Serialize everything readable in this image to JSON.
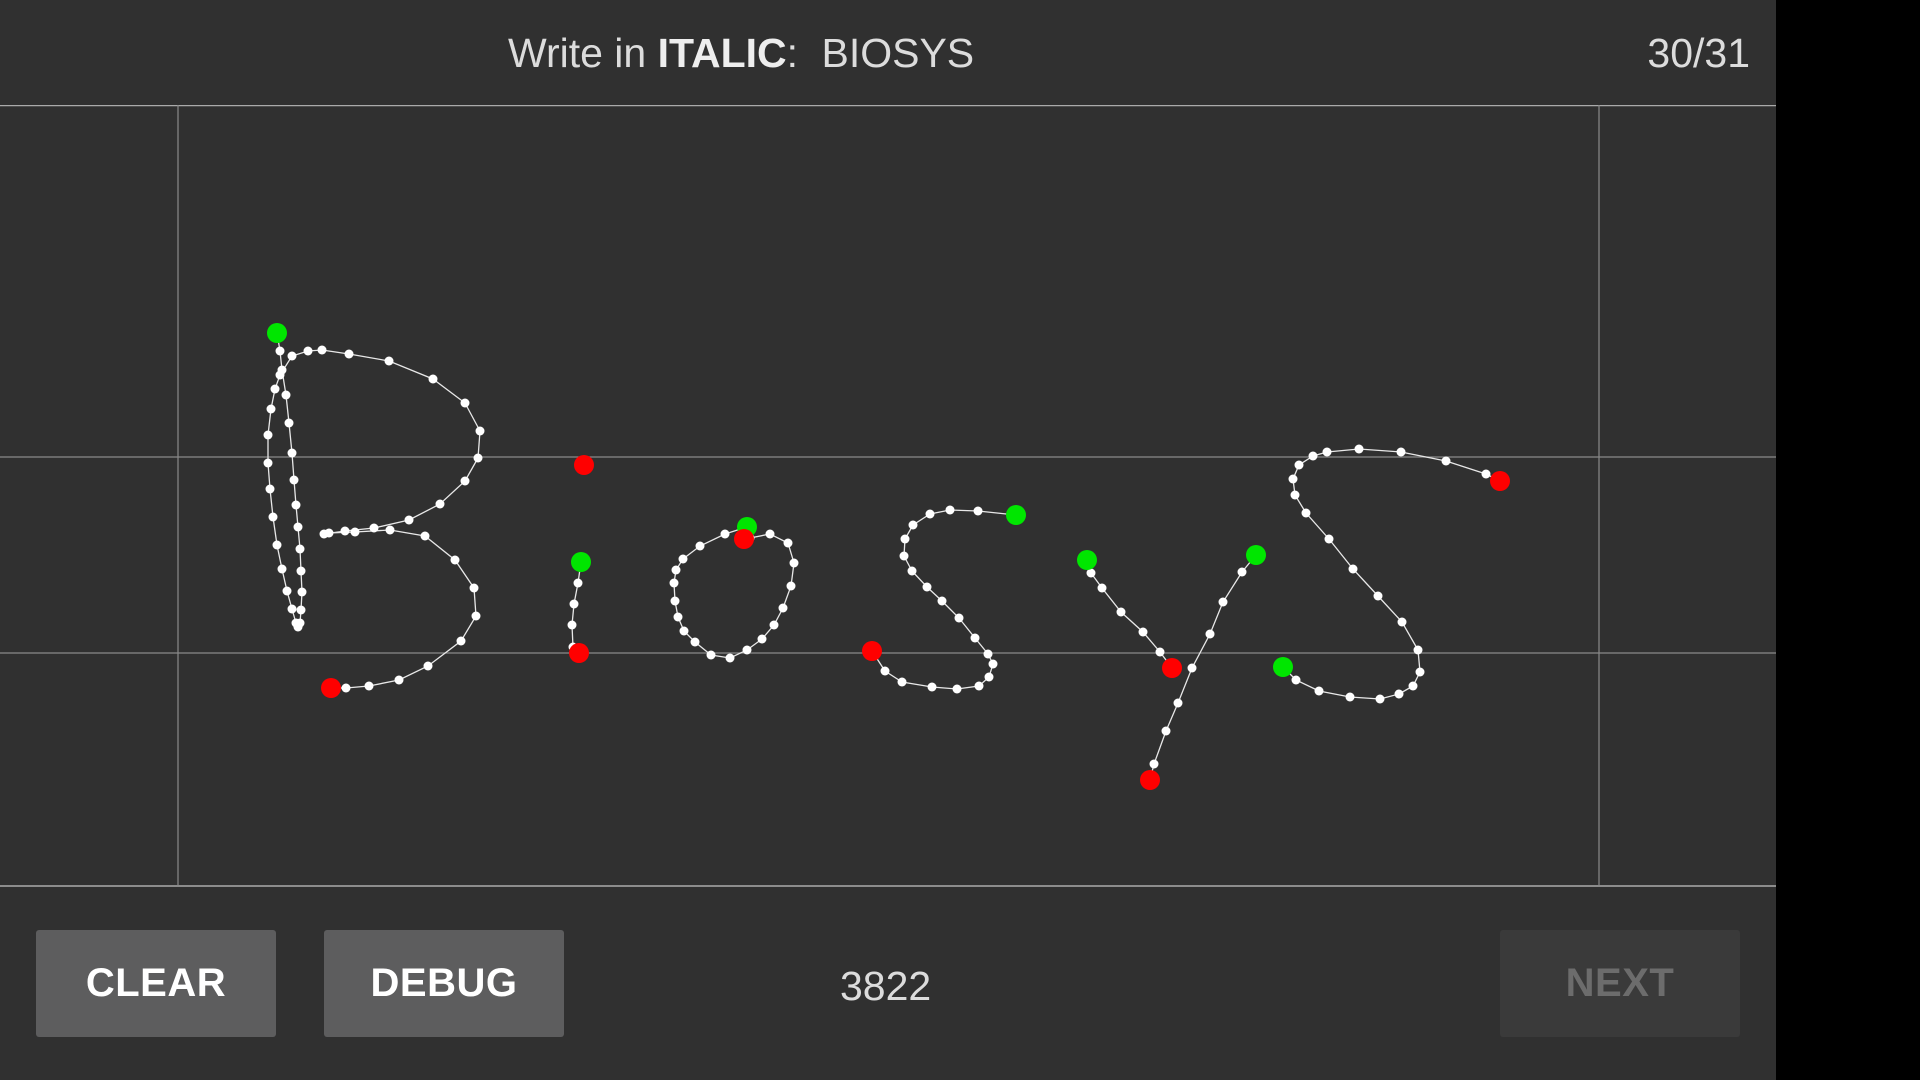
{
  "header": {
    "prompt_prefix": "Write in",
    "prompt_style": "ITALIC",
    "prompt_colon": ":",
    "target_word": "BIOSYS",
    "progress": "30/31"
  },
  "footer": {
    "clear_label": "CLEAR",
    "debug_label": "DEBUG",
    "score": "3822",
    "next_label": "NEXT"
  },
  "colors": {
    "background": "#303030",
    "stroke": "#ffffff",
    "stroke_start": "#00e600",
    "stroke_end": "#ff0000",
    "guideline": "#8a8a8a"
  }
}
